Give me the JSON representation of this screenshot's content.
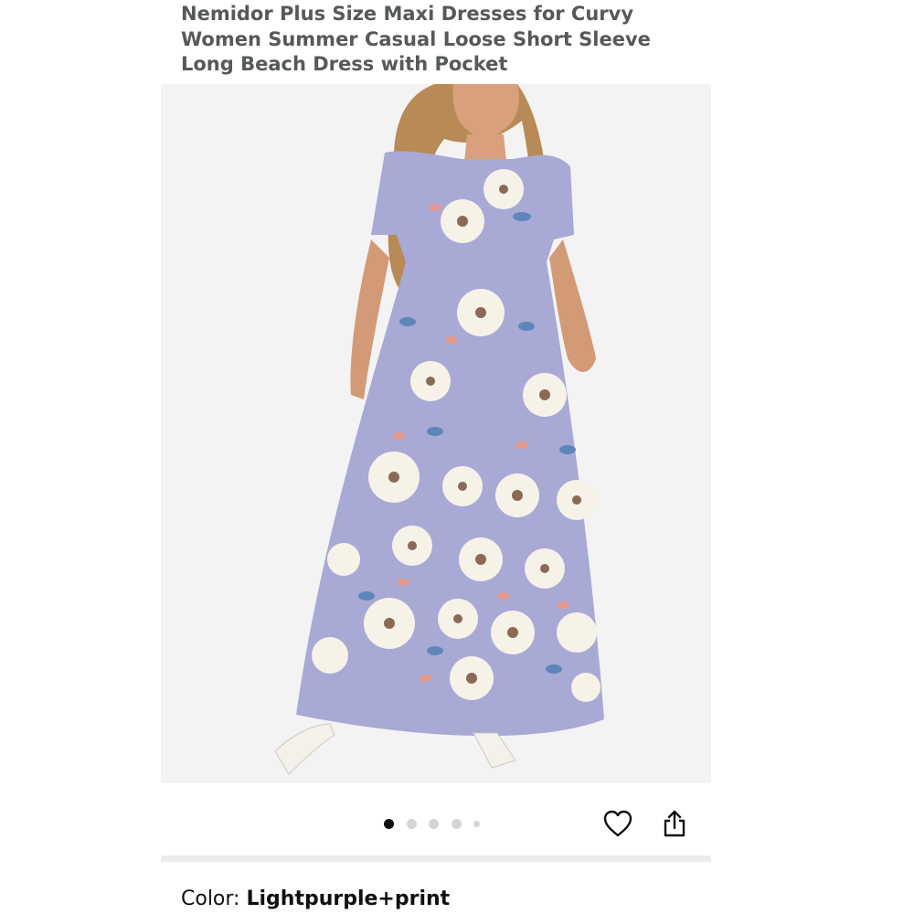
{
  "product": {
    "title": "Nemidor Plus Size Maxi Dresses for Curvy Women Summer Casual Loose Short Sleeve Long Beach Dress with Pocket"
  },
  "gallery": {
    "image_alt": "Model wearing light purple floral maxi dress",
    "image_count": 5,
    "active_index": 0,
    "dress_color": "#a9a9d6",
    "background_color": "#f3f3f3"
  },
  "actions": {
    "favorite_icon": "heart-icon",
    "share_icon": "share-icon"
  },
  "variation": {
    "color_label": "Color: ",
    "color_value": "Lightpurple+print"
  }
}
